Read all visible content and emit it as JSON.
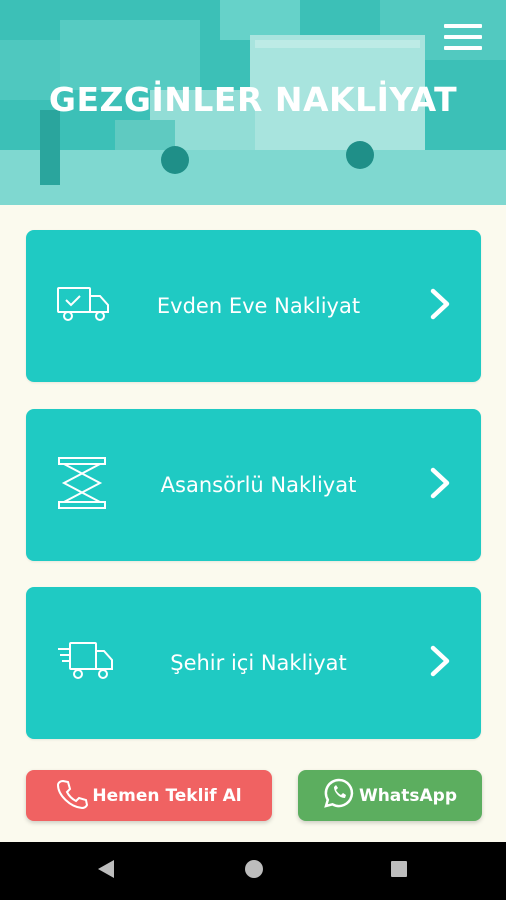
{
  "header": {
    "title": "GEZGİNLER NAKLİYAT",
    "menu_icon": "hamburger-menu-icon",
    "background": "moving-truck-photo"
  },
  "services": [
    {
      "label": "Evden Eve Nakliyat",
      "icon": "truck-check-icon"
    },
    {
      "label": "Asansörlü Nakliyat",
      "icon": "scissor-lift-icon"
    },
    {
      "label": "Şehir içi Nakliyat",
      "icon": "fast-delivery-truck-icon"
    }
  ],
  "actions": {
    "quote_label": "Hemen Teklif Al",
    "whatsapp_label": "WhatsApp"
  },
  "colors": {
    "accent": "#1fcac3",
    "background": "#fbfaee",
    "quote_button": "#f06262",
    "whatsapp_button": "#5cae5f",
    "navbar": "#000000"
  },
  "navbar": {
    "back_icon": "back-triangle-icon",
    "home_icon": "home-circle-icon",
    "recents_icon": "recents-square-icon"
  }
}
